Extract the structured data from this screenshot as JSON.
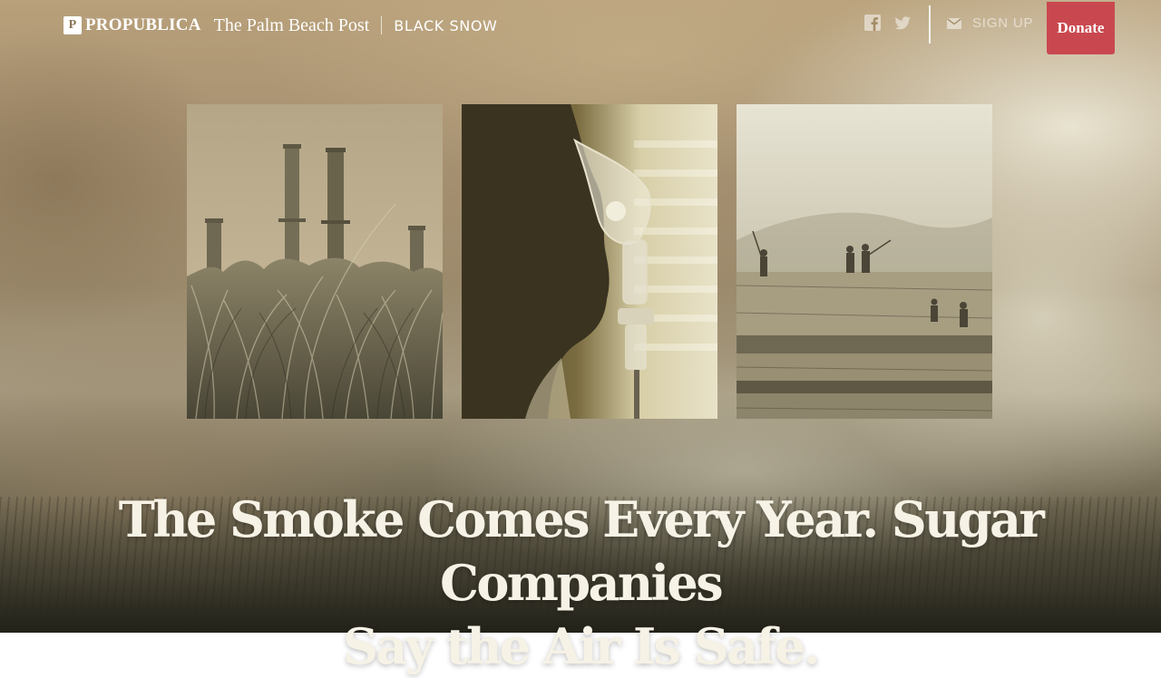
{
  "header": {
    "propublica_logo": "ProPublica",
    "propublica_mark": "P",
    "partner": "The Palm Beach Post",
    "series": "BLACK SNOW",
    "social": {
      "facebook_icon": "facebook-icon",
      "twitter_icon": "twitter-icon"
    },
    "signup_icon": "envelope-icon",
    "signup_label": "SIGN UP",
    "donate_label": "Donate"
  },
  "photos": [
    {
      "subject": "smokestacks-and-sugarcane"
    },
    {
      "subject": "person-with-nebulizer-mask"
    },
    {
      "subject": "workers-in-burning-field"
    }
  ],
  "headline": {
    "line1": "The Smoke Comes Every Year. Sugar Companies",
    "line2": "Say the Air Is Safe."
  },
  "colors": {
    "donate": "#c9484f",
    "headline": "#f6f2e6"
  }
}
